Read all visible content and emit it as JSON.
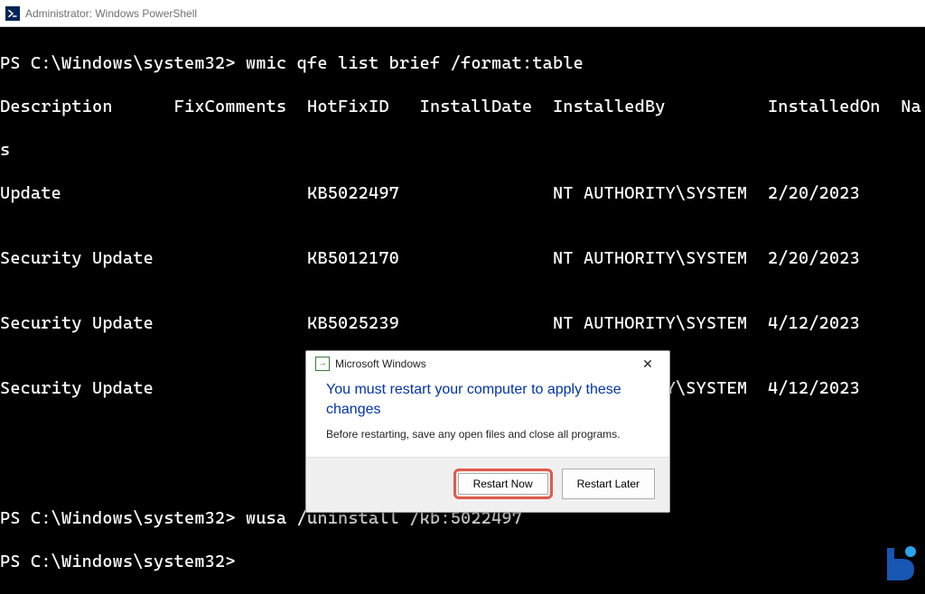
{
  "window": {
    "title": "Administrator: Windows PowerShell"
  },
  "terminal": {
    "prompt": "PS C:\\Windows\\system32>",
    "cmd1": "wmic qfe list brief /format:table",
    "header_line": "Description      FixComments  HotFixID   InstallDate  InstalledBy          InstalledOn  Na",
    "wrap_s": "s",
    "rows": [
      "Update                        KB5022497               NT AUTHORITY\\SYSTEM  2/20/2023",
      "",
      "Security Update               KB5012170               NT AUTHORITY\\SYSTEM  2/20/2023",
      "",
      "Security Update               KB5025239               NT AUTHORITY\\SYSTEM  4/12/2023",
      "",
      "Security Update               KB5025749               NT AUTHORITY\\SYSTEM  4/12/2023"
    ],
    "cmd2": "wusa /uninstall /kb:5022497"
  },
  "dialog": {
    "title": "Microsoft Windows",
    "heading": "You must restart your computer to apply these changes",
    "body": "Before restarting, save any open files and close all programs.",
    "restart_now": "Restart Now",
    "restart_later": "Restart Later"
  }
}
